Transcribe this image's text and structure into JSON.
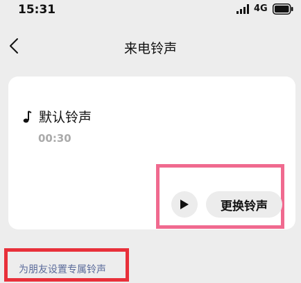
{
  "status_bar": {
    "time": "15:31",
    "network": "4G",
    "signal_icon": "signal-icon",
    "battery_icon": "battery-icon"
  },
  "nav": {
    "back_icon": "chevron-left-icon",
    "title": "来电铃声"
  },
  "ringtone": {
    "icon": "music-note-icon",
    "name": "默认铃声",
    "duration": "00:30"
  },
  "actions": {
    "play_icon": "play-icon",
    "change_label": "更换铃声"
  },
  "friend_link": {
    "label": "为朋友设置专属铃声"
  },
  "colors": {
    "background": "#ededed",
    "card": "#ffffff",
    "button_bg": "#ececec",
    "highlight_pink": "#f06a8f",
    "highlight_red": "#e8303a",
    "link_color": "#5b6b9a",
    "muted_text": "#aaaaaa"
  }
}
